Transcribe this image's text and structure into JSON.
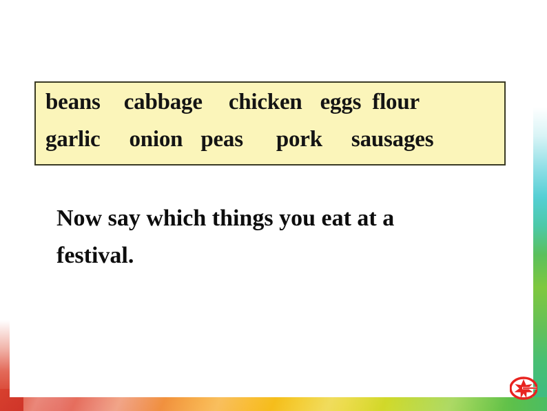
{
  "slide": {
    "background_color": "#ffffff",
    "box": {
      "background_color": "#fbf5ba",
      "border_color": "#3a3a24",
      "rows": [
        [
          "beans",
          "cabbage",
          "chicken",
          "eggs",
          "flour"
        ],
        [
          "garlic",
          "onion",
          "peas",
          "pork",
          "sausages"
        ]
      ]
    },
    "instruction": {
      "line1": "Now say which things you eat at a",
      "line2": "festival."
    },
    "logo": {
      "name": "publisher-star-logo",
      "color": "#e8231f"
    },
    "decor": {
      "right_border_colors": [
        "#8fdfe6",
        "#55cfd4",
        "#5bc05c",
        "#7fc83f",
        "#3dba86"
      ],
      "bottom_border_colors": [
        "#d8402e",
        "#ef8a46",
        "#f8b61c",
        "#cfd92a",
        "#5cc04c"
      ],
      "left_border_color": "#d8402e"
    }
  }
}
